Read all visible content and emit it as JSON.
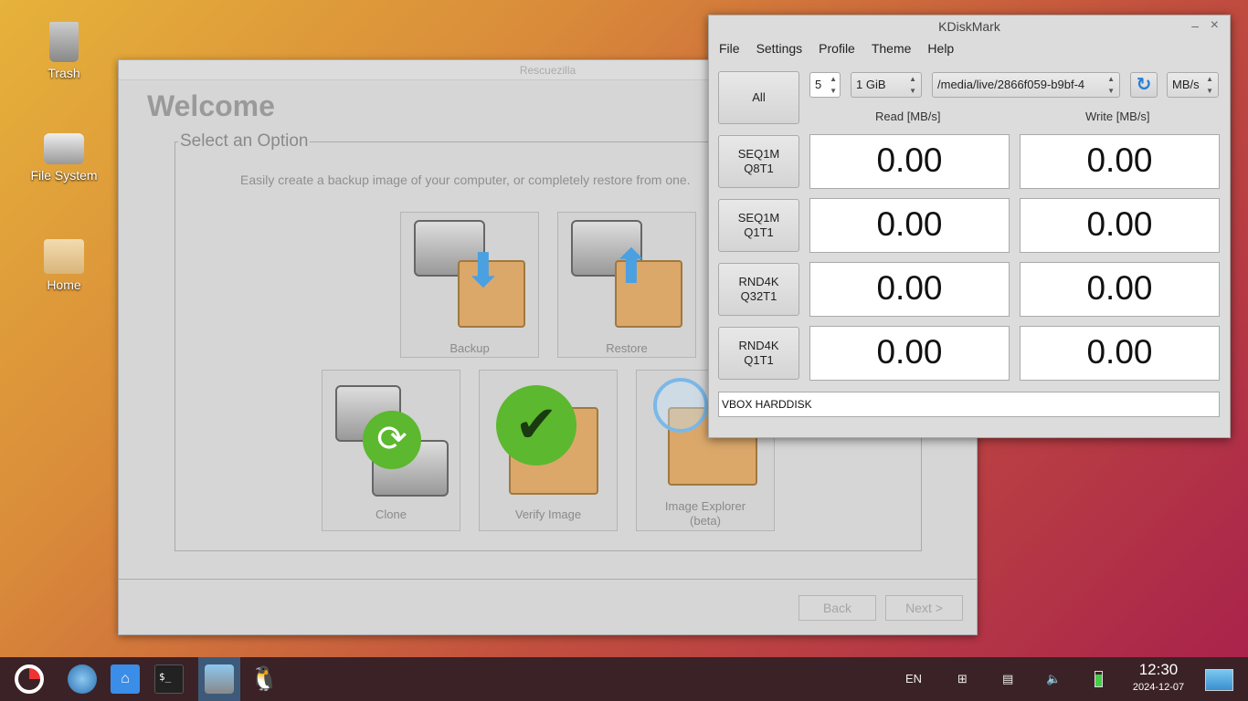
{
  "desktop": {
    "icons": [
      {
        "label": "Trash",
        "icon": "trash-icon"
      },
      {
        "label": "File System",
        "icon": "hard-drive-icon"
      },
      {
        "label": "Home",
        "icon": "home-folder-icon"
      }
    ]
  },
  "rescuezilla": {
    "title": "Rescuezilla",
    "heading": "Welcome",
    "group_title": "Select an Option",
    "description": "Easily create a backup image of your computer, or completely restore from one.",
    "options": [
      {
        "label": "Backup"
      },
      {
        "label": "Restore"
      },
      {
        "label": "Clone"
      },
      {
        "label": "Verify Image"
      },
      {
        "label": "Image Explorer",
        "sub": "(beta)"
      }
    ],
    "back": "Back",
    "next": "Next >"
  },
  "kdiskmark": {
    "title": "KDiskMark",
    "minimize": "–",
    "close": "×",
    "menu": [
      "File",
      "Settings",
      "Profile",
      "Theme",
      "Help"
    ],
    "all": "All",
    "runs": "5",
    "size": "1 GiB",
    "path": "/media/live/2866f059-b9bf-4",
    "unit": "MB/s",
    "read_header": "Read [MB/s]",
    "write_header": "Write [MB/s]",
    "rows": [
      {
        "l1": "SEQ1M",
        "l2": "Q8T1",
        "read": "0.00",
        "write": "0.00"
      },
      {
        "l1": "SEQ1M",
        "l2": "Q1T1",
        "read": "0.00",
        "write": "0.00"
      },
      {
        "l1": "RND4K",
        "l2": "Q32T1",
        "read": "0.00",
        "write": "0.00"
      },
      {
        "l1": "RND4K",
        "l2": "Q1T1",
        "read": "0.00",
        "write": "0.00"
      }
    ],
    "device": "VBOX HARDDISK"
  },
  "taskbar": {
    "apps": [
      "app-menu-icon",
      "web-browser-icon",
      "file-manager-icon",
      "terminal-icon",
      "rescuezilla-icon",
      "kdiskmark-penguin-icon"
    ],
    "lang": "EN",
    "time": "12:30",
    "date": "2024-12-07"
  }
}
